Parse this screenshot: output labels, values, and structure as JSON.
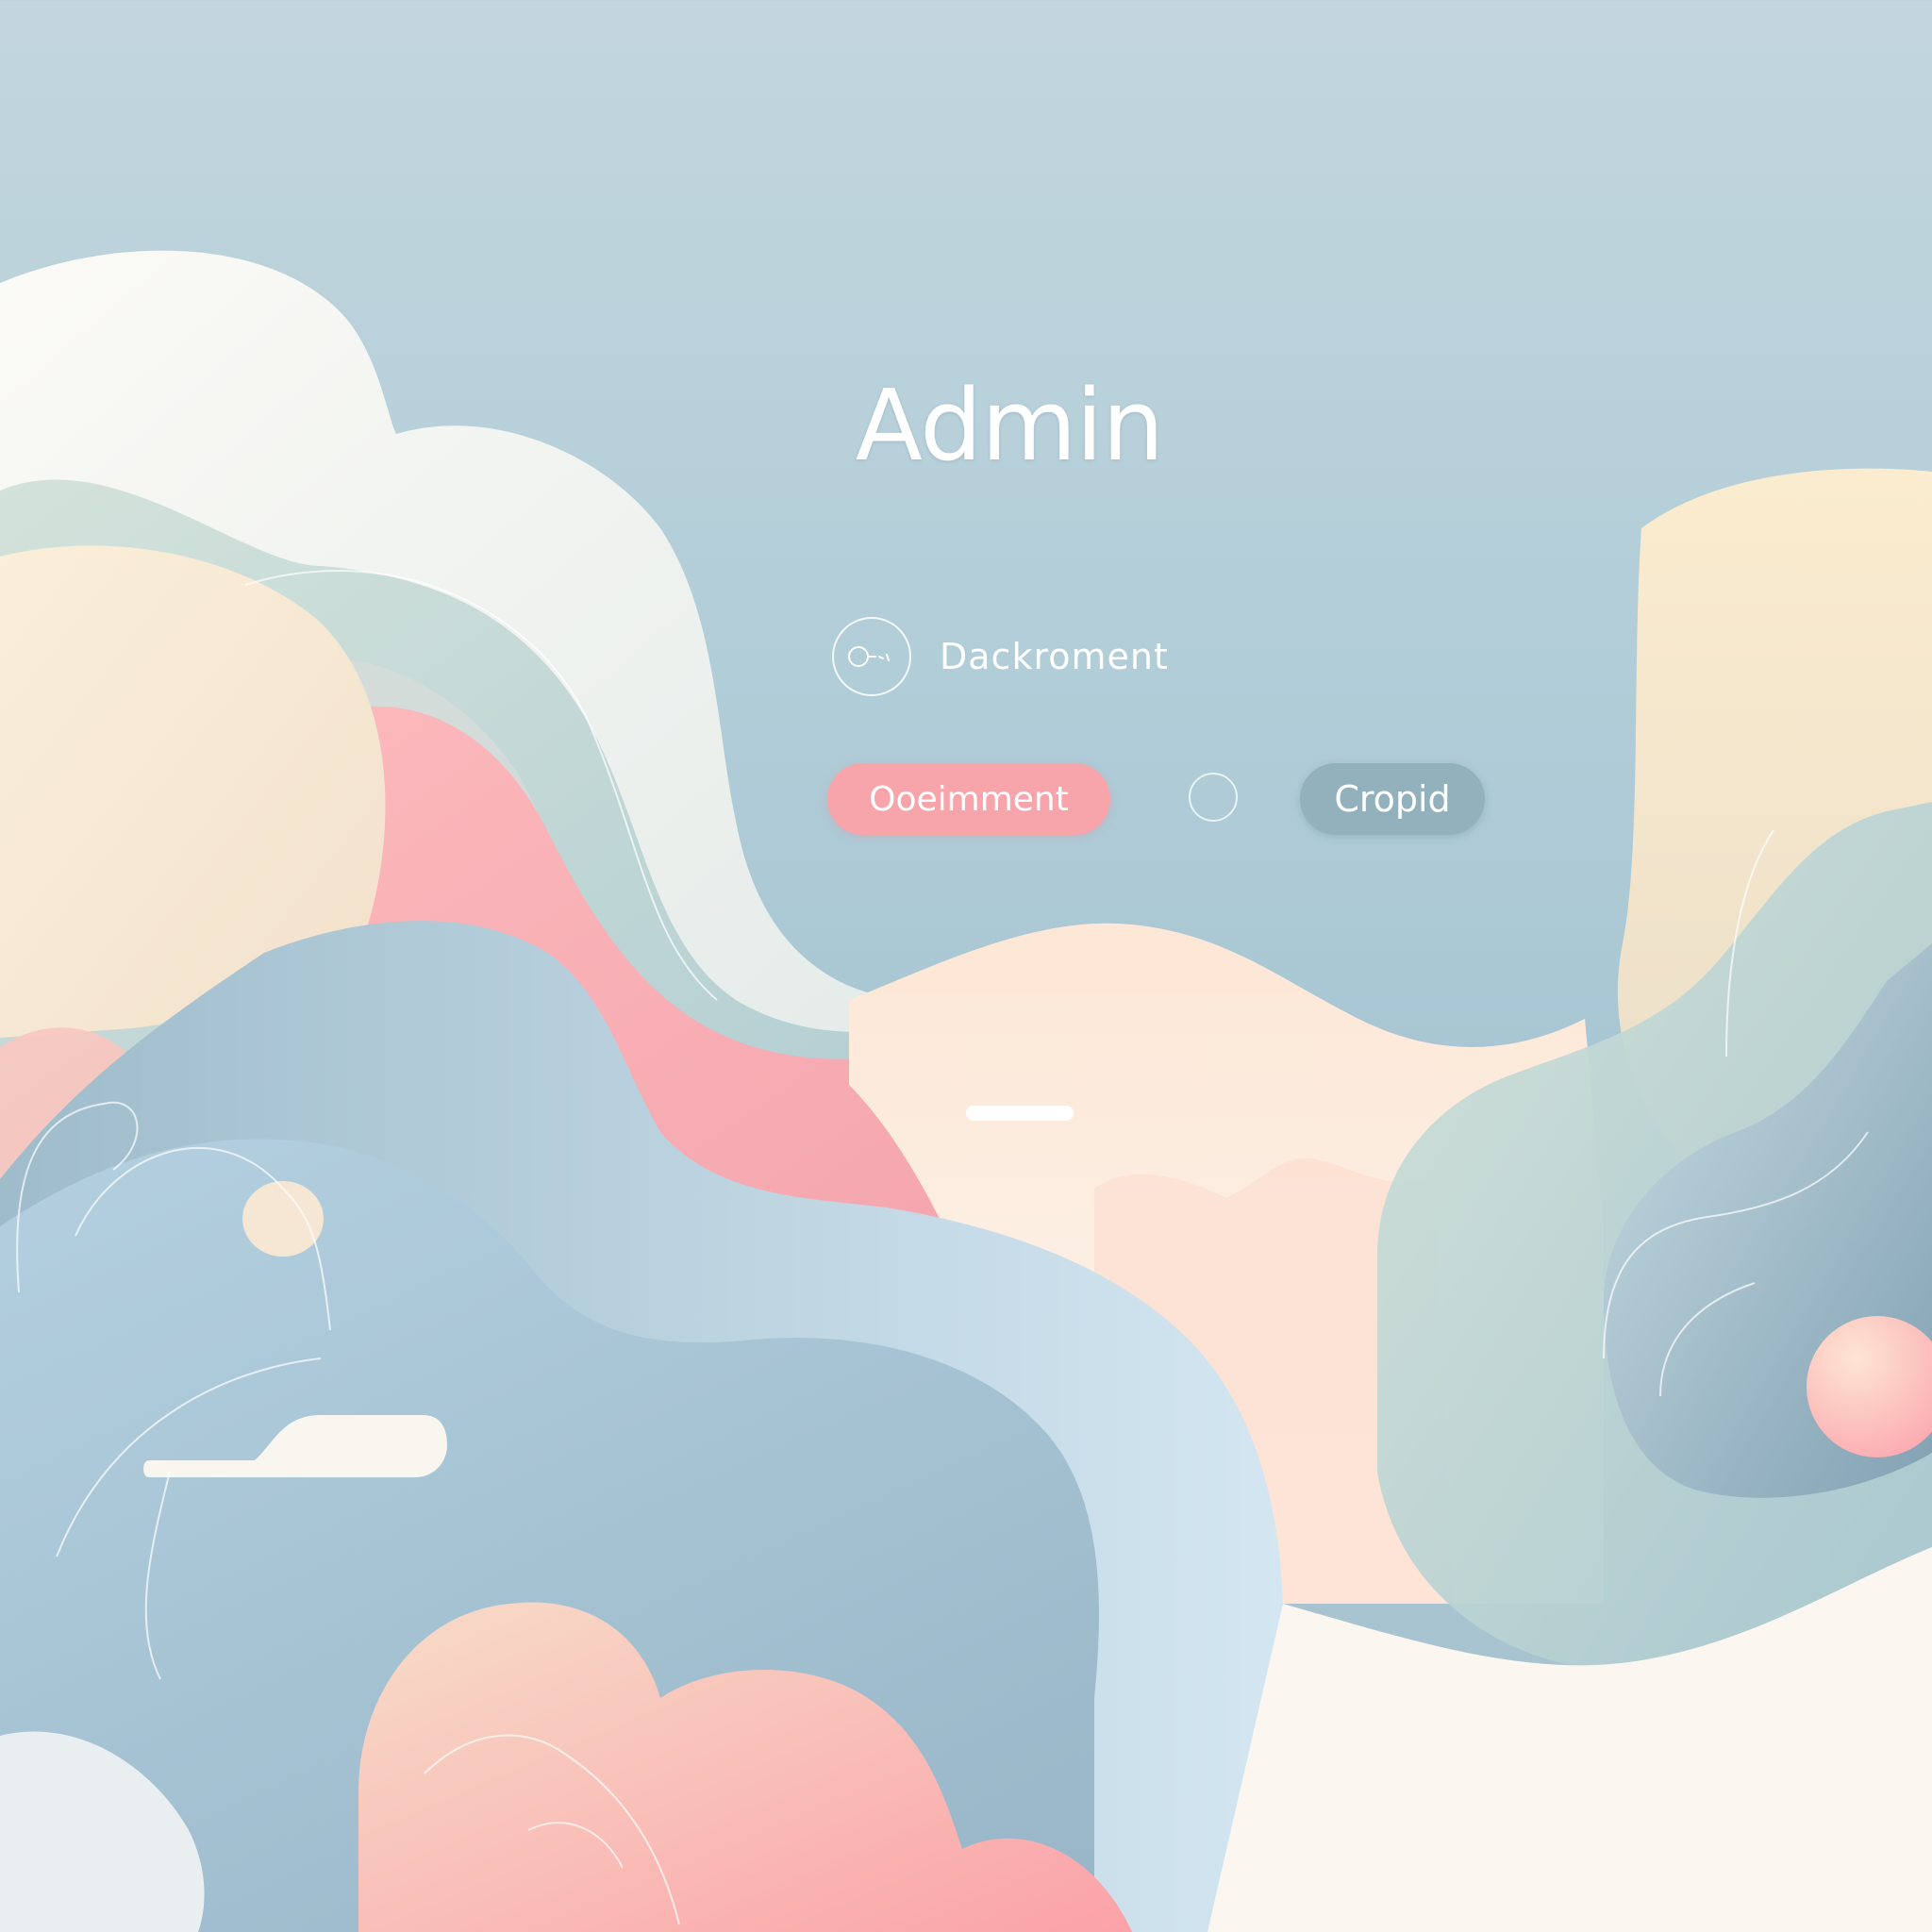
{
  "title": "Admin",
  "account": {
    "label": "Dackroment",
    "icon": "user-avatar-icon"
  },
  "actions": {
    "primary_label": "Ooeimment",
    "radio_icon": "radio-circle-icon",
    "secondary_label": "Cropid"
  },
  "colors": {
    "background": "#a9c4d1",
    "primary_button": "#f7a5ab",
    "secondary_button": "#93b1bd",
    "text": "#ffffff"
  }
}
